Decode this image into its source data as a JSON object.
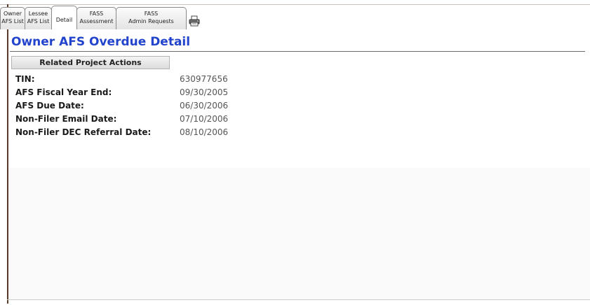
{
  "tabs": [
    {
      "line1": "Owner",
      "line2": "AFS List",
      "active": false
    },
    {
      "line1": "Lessee",
      "line2": "AFS List",
      "active": false
    },
    {
      "line1": "",
      "line2": "Detail",
      "active": true
    },
    {
      "line1": "FASS",
      "line2": "Assessment",
      "active": false
    },
    {
      "line1": "FASS",
      "line2": "Admin Requests",
      "active": false
    }
  ],
  "toolbar": {
    "print_icon": "printer-icon"
  },
  "page": {
    "title": "Owner AFS Overdue Detail",
    "related_button_label": "Related Project Actions"
  },
  "fields": [
    {
      "label": "TIN:",
      "value": "630977656"
    },
    {
      "label": "AFS Fiscal Year End:",
      "value": "09/30/2005"
    },
    {
      "label": "AFS Due Date:",
      "value": "06/30/2006"
    },
    {
      "label": "Non-Filer Email Date:",
      "value": "07/10/2006"
    },
    {
      "label": "Non-Filer DEC Referral Date:",
      "value": "08/10/2006"
    }
  ],
  "colors": {
    "title": "#2244cc",
    "frame_border": "#5a3a2a"
  }
}
